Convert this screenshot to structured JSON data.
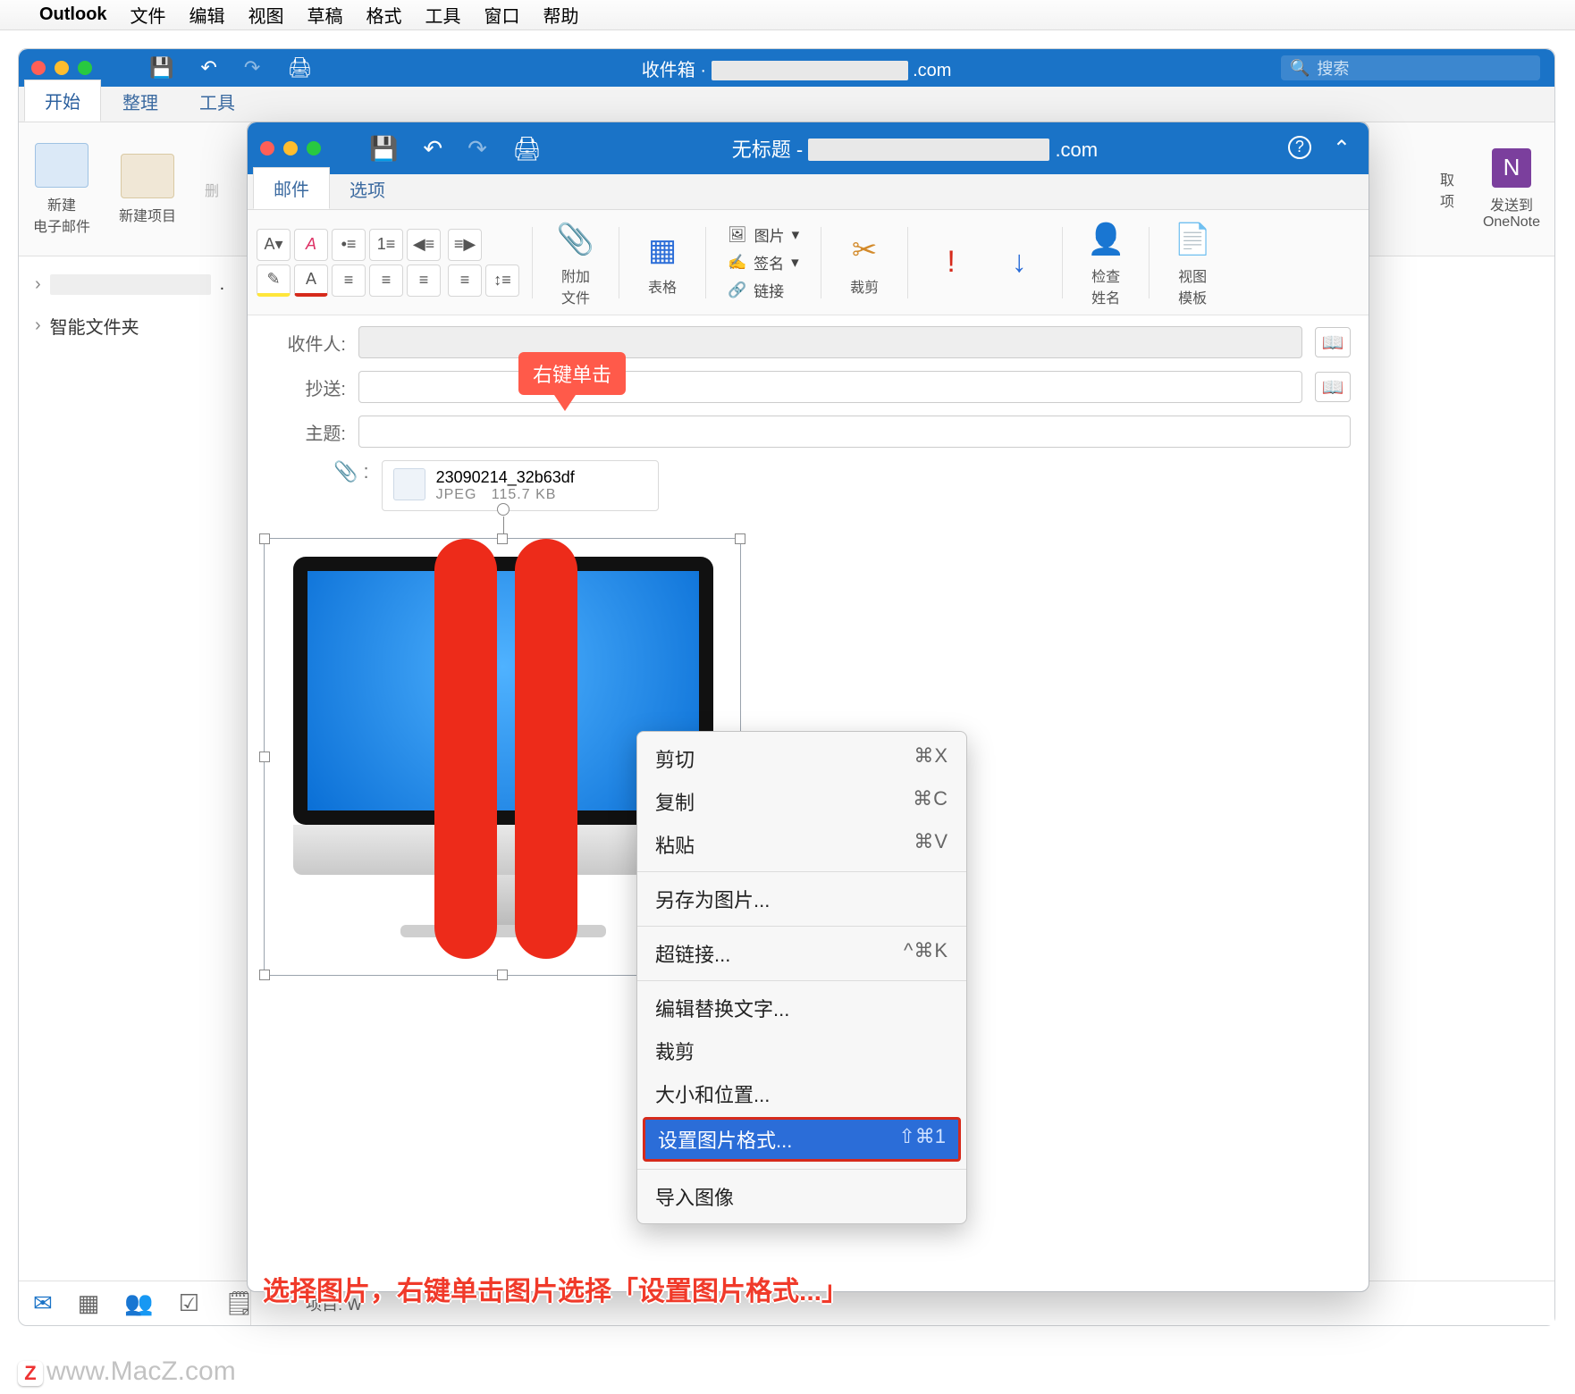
{
  "mac_menu": {
    "app_name": "Outlook",
    "items": [
      "文件",
      "编辑",
      "视图",
      "草稿",
      "格式",
      "工具",
      "窗口",
      "帮助"
    ]
  },
  "main_window": {
    "title_prefix": "收件箱 ·",
    "title_suffix": ".com",
    "search_placeholder": "搜索",
    "tabs": [
      "开始",
      "整理",
      "工具"
    ],
    "ribbon": {
      "new_email": "新建\n电子邮件",
      "new_item": "新建项目",
      "delete": "删",
      "get": "取\n项",
      "send_onenote": "发送到\nOneNote"
    },
    "sidebar": {
      "smart_folders": "智能文件夹"
    },
    "footer_count": "项目: W"
  },
  "compose": {
    "title_prefix": "无标题 -",
    "title_suffix": ".com",
    "tabs": [
      "邮件",
      "选项"
    ],
    "ribbon": {
      "attach": "附加\n文件",
      "table": "表格",
      "picture": "图片",
      "signature": "签名",
      "link": "链接",
      "crop": "裁剪",
      "check_names": "检查\n姓名",
      "view_template": "视图\n模板",
      "font_sample": "A"
    },
    "fields": {
      "to_label": "收件人:",
      "cc_label": "抄送:",
      "subject_label": "主题:"
    },
    "attachment": {
      "name": "23090214_32b63df",
      "type": "JPEG",
      "size": "115.7 KB"
    }
  },
  "callout": "右键单击",
  "context_menu": {
    "cut": "剪切",
    "cut_sc": "⌘X",
    "copy": "复制",
    "copy_sc": "⌘C",
    "paste": "粘贴",
    "paste_sc": "⌘V",
    "save_as_pic": "另存为图片...",
    "hyperlink": "超链接...",
    "hyperlink_sc": "^⌘K",
    "edit_alt": "编辑替换文字...",
    "crop": "裁剪",
    "size_pos": "大小和位置...",
    "format_pic": "设置图片格式...",
    "format_pic_sc": "⇧⌘1",
    "import_image": "导入图像"
  },
  "instruction": "选择图片，右键单击图片选择「设置图片格式...」",
  "watermark": "www.MacZ.com",
  "watermark_badge": "Z"
}
